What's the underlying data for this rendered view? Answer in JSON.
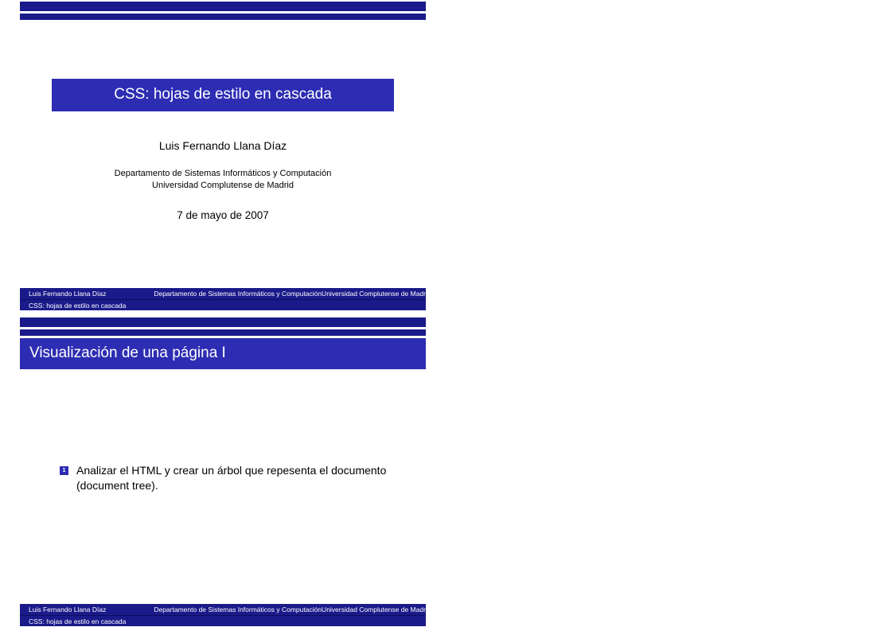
{
  "slide1": {
    "title": "CSS: hojas de estilo en cascada",
    "author": "Luis Fernando Llana Díaz",
    "department_line1": "Departamento de Sistemas Informáticos y Computación",
    "department_line2": "Universidad Complutense de Madrid",
    "date": "7 de mayo de 2007"
  },
  "slide2": {
    "heading": "Visualización de una página I",
    "items": [
      {
        "n": "1",
        "text": "Analizar el HTML y crear un árbol que repesenta el documento (document tree)."
      }
    ]
  },
  "footer": {
    "author": "Luis Fernando Llana Díaz",
    "dept": "Departamento de Sistemas Informáticos y ComputaciónUniversidad Complutense de Madrid",
    "title": "CSS: hojas de estilo en cascada"
  }
}
